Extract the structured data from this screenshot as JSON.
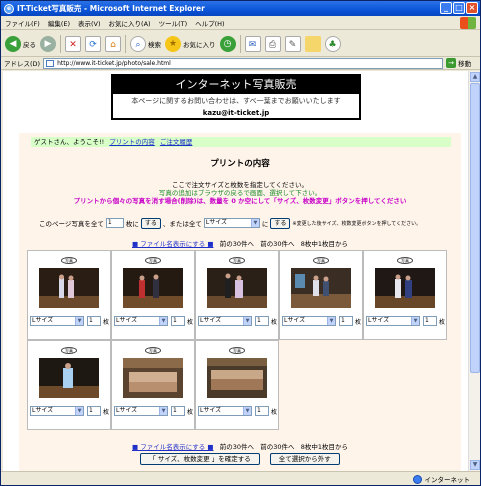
{
  "window": {
    "title": "IT-Ticket写真販売 - Microsoft Internet Explorer",
    "min": "_",
    "max": "□",
    "close": "×"
  },
  "menu": [
    "ファイル(F)",
    "編集(E)",
    "表示(V)",
    "お気に入り(A)",
    "ツール(T)",
    "ヘルプ(H)"
  ],
  "toolbar": {
    "back": "戻る",
    "search": "検索",
    "favorites": "お気に入り"
  },
  "address": {
    "label": "アドレス(D)",
    "url": "http://www.it-ticket.jp/photo/sale.html",
    "go": "移動"
  },
  "banner": {
    "title": "インターネット写真販売",
    "line1": "本ページに関するお問い合わせは、すべ一葉までお願いいたします",
    "email": "kazu@it-ticket.jp"
  },
  "welcome": {
    "text": "ゲストさん、ようこそ!!",
    "link1": "プリントの内容",
    "link2": "ご注文履歴"
  },
  "heading": "プリントの内容",
  "instructions": {
    "line1": "ここで注文サイズと枚数を指定してください。",
    "line2": "写真の追加はブラウザの戻るで画面、選択して下さい。",
    "line3": "プリントから個々の写真を消す場合(削除)は、数量を 0 か空にして「サイズ、枚数変更」ボタンを押してください"
  },
  "bulk": {
    "prefix": "このページ写真を全て",
    "qty": "1",
    "unit": "枚に",
    "apply": "する",
    "mid": "、または全て",
    "size": "Lサイズ",
    "ni": "に",
    "apply2": "する",
    "note": "※変更した後サイズ、枚数変更ボタンを押してください。"
  },
  "nav": {
    "toggle": "■ ファイル名表示にする ■",
    "prev": "前の30件へ",
    "next": "前の30件へ",
    "range": "8枚中1枚目から"
  },
  "items": [
    {
      "logo": "写真",
      "size": "Lサイズ",
      "qty": "1",
      "unit": "枚"
    },
    {
      "logo": "写真",
      "size": "Lサイズ",
      "qty": "1",
      "unit": "枚"
    },
    {
      "logo": "写真",
      "size": "Lサイズ",
      "qty": "1",
      "unit": "枚"
    },
    {
      "logo": "写真",
      "size": "Lサイズ",
      "qty": "1",
      "unit": "枚"
    },
    {
      "logo": "写真",
      "size": "Lサイズ",
      "qty": "1",
      "unit": "枚"
    },
    {
      "logo": "写真",
      "size": "Lサイズ",
      "qty": "1",
      "unit": "枚"
    },
    {
      "logo": "写真",
      "size": "Lサイズ",
      "qty": "1",
      "unit": "枚"
    },
    {
      "logo": "写真",
      "size": "Lサイズ",
      "qty": "1",
      "unit": "枚"
    }
  ],
  "buttons": {
    "confirm": "「 サイズ、枚数変更 」を確定する",
    "deselect": "全て選択から外す"
  },
  "status": {
    "zone": "インターネット"
  }
}
